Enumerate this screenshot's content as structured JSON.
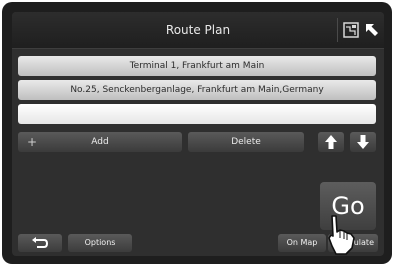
{
  "header": {
    "title": "Route Plan",
    "icons": [
      "map-toggle-icon",
      "cursor-icon"
    ]
  },
  "route": {
    "items": [
      {
        "label": "Terminal 1, Frankfurt am Main"
      },
      {
        "label": "No.25, Senckenberganlage, Frankfurt am Main,Germany"
      },
      {
        "label": ""
      }
    ]
  },
  "actions": {
    "add_label": "Add",
    "add_icon": "plus-icon",
    "delete_label": "Delete",
    "up_icon": "arrow-up-icon",
    "down_icon": "arrow-down-icon"
  },
  "go": {
    "label": "Go"
  },
  "footer": {
    "back_icon": "back-icon",
    "options_label": "Options",
    "on_map_label": "On Map",
    "simulate_label": "Simulate",
    "pointer_icon": "hand-pointer-icon"
  }
}
